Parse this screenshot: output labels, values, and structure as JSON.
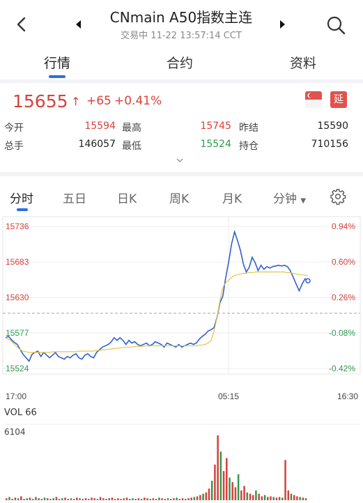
{
  "header": {
    "title": "CNmain A50指数主连",
    "subtitle": "交易中 11-22 13:57:14 CCT"
  },
  "tabs": [
    {
      "label": "行情",
      "active": true
    },
    {
      "label": "合约",
      "active": false
    },
    {
      "label": "资料",
      "active": false
    }
  ],
  "quote": {
    "price": "15655",
    "arrow": "↑",
    "change": "+65",
    "change_pct": "+0.41%",
    "delay_badge": "延",
    "flag_icon": "singapore-flag-icon",
    "stats": [
      {
        "label": "今开",
        "value": "15594",
        "color": "red"
      },
      {
        "label": "最高",
        "value": "15745",
        "color": "red"
      },
      {
        "label": "昨结",
        "value": "15590",
        "color": "dark"
      },
      {
        "label": "总手",
        "value": "146057",
        "color": "dark"
      },
      {
        "label": "最低",
        "value": "15524",
        "color": "green"
      },
      {
        "label": "持仓",
        "value": "710156",
        "color": "dark"
      }
    ]
  },
  "period_tabs": [
    {
      "label": "分时",
      "active": true
    },
    {
      "label": "五日",
      "active": false
    },
    {
      "label": "日K",
      "active": false
    },
    {
      "label": "周K",
      "active": false
    },
    {
      "label": "月K",
      "active": false
    },
    {
      "label": "分钟",
      "active": false
    }
  ],
  "colors": {
    "up": "#d8413c",
    "down": "#2e9b4e",
    "price_line": "#2f5fd0",
    "avg_line": "#e5c34a",
    "accent": "#2f6de1"
  },
  "chart_data": {
    "type": "line",
    "y_labels": [
      "15736",
      "15683",
      "15630",
      "15577",
      "15524"
    ],
    "pct_labels": [
      "0.94%",
      "0.60%",
      "0.26%",
      "-0.08%",
      "-0.42%"
    ],
    "x_labels": [
      "17:00",
      "05:15",
      "16:30"
    ],
    "ylim": [
      15524,
      15736
    ],
    "prev_settle": 15590,
    "series": [
      {
        "values": [
          15570,
          15572,
          15567,
          15563,
          15560,
          15552,
          15545,
          15540,
          15535,
          15545,
          15548,
          15550,
          15542,
          15548,
          15544,
          15540,
          15544,
          15548,
          15542,
          15540,
          15538,
          15542,
          15540,
          15544,
          15546,
          15540,
          15538,
          15544,
          15546,
          15542,
          15540,
          15548,
          15552,
          15556,
          15558,
          15560,
          15564,
          15570,
          15566,
          15570,
          15566,
          15560,
          15566,
          15562,
          15564,
          15560,
          15558,
          15560,
          15562,
          15558,
          15560,
          15564,
          15562,
          15560,
          15556,
          15562,
          15560,
          15558,
          15556,
          15560,
          15556,
          15558,
          15560,
          15562,
          15560,
          15562,
          15568,
          15572,
          15575,
          15580,
          15582,
          15585,
          15600,
          15622,
          15632,
          15660,
          15683,
          15710,
          15728,
          15715,
          15700,
          15680,
          15668,
          15675,
          15690,
          15682,
          15670,
          15678,
          15672,
          15676,
          15674,
          15676,
          15677,
          15678,
          15677,
          15678,
          15676,
          15670,
          15660,
          15650,
          15640,
          15650,
          15658,
          15655
        ]
      },
      {
        "values": [
          15570,
          15568,
          15565,
          15560,
          15556,
          15552,
          15550,
          15549,
          15548,
          15548,
          15548,
          15548,
          15548,
          15548,
          15548,
          15548,
          15549,
          15549,
          15549,
          15549,
          15549,
          15549,
          15549,
          15549,
          15549,
          15550,
          15550,
          15550,
          15550,
          15550,
          15550,
          15551,
          15551,
          15552,
          15552,
          15553,
          15553,
          15554,
          15554,
          15555,
          15555,
          15556,
          15556,
          15556,
          15557,
          15557,
          15557,
          15557,
          15558,
          15558,
          15558,
          15558,
          15558,
          15558,
          15558,
          15558,
          15558,
          15558,
          15558,
          15558,
          15558,
          15558,
          15558,
          15558,
          15558,
          15558,
          15559,
          15559,
          15560,
          15562,
          15566,
          15580,
          15600,
          15625,
          15645,
          15652,
          15656,
          15660,
          15663,
          15664,
          15665,
          15666,
          15666,
          15667,
          15667,
          15668,
          15668,
          15668,
          15668,
          15668,
          15668,
          15668,
          15668,
          15668,
          15668,
          15668,
          15667,
          15667,
          15666,
          15665,
          15664,
          15664,
          15663,
          15663
        ]
      }
    ]
  },
  "volume": {
    "label": "VOL",
    "latest": "66",
    "max_label": "6104",
    "bars": [
      0.03,
      0.05,
      0.02,
      0.04,
      0.03,
      0.06,
      0.02,
      0.03,
      0.04,
      0.02,
      0.05,
      0.03,
      0.02,
      0.04,
      0.03,
      0.02,
      0.03,
      0.05,
      0.02,
      0.03,
      0.04,
      0.02,
      0.03,
      0.02,
      0.04,
      0.03,
      0.02,
      0.03,
      0.02,
      0.04,
      0.03,
      0.02,
      0.05,
      0.03,
      0.02,
      0.03,
      0.04,
      0.02,
      0.03,
      0.02,
      0.03,
      0.04,
      0.02,
      0.03,
      0.02,
      0.03,
      0.02,
      0.04,
      0.03,
      0.02,
      0.03,
      0.02,
      0.04,
      0.03,
      0.02,
      0.03,
      0.02,
      0.03,
      0.04,
      0.02,
      0.03,
      0.02,
      0.03,
      0.04,
      0.05,
      0.06,
      0.08,
      0.1,
      0.12,
      0.18,
      0.3,
      0.55,
      1.0,
      0.75,
      0.45,
      0.65,
      0.35,
      0.28,
      0.2,
      0.4,
      0.15,
      0.22,
      0.12,
      0.1,
      0.08,
      0.15,
      0.1,
      0.06,
      0.08,
      0.05,
      0.06,
      0.05,
      0.04,
      0.05,
      0.04,
      0.62,
      0.15,
      0.1,
      0.08,
      0.06,
      0.05,
      0.04,
      0.03
    ]
  }
}
